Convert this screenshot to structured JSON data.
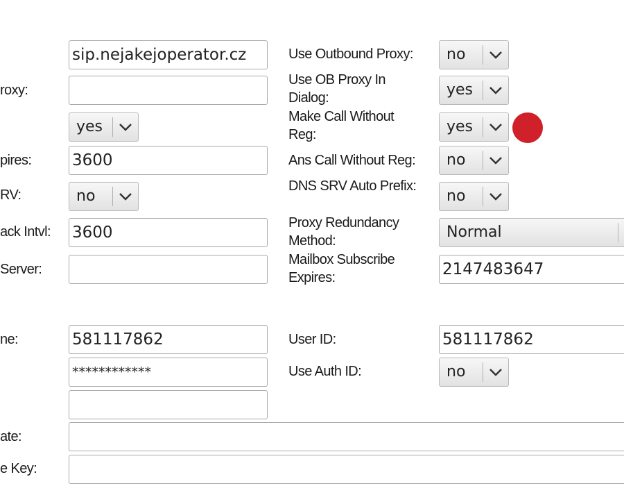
{
  "left": {
    "server_value": "sip.nejakejoperator.cz",
    "proxy_label": "roxy:",
    "proxy_value": "",
    "toggle_value": "yes",
    "expires_label": "pires:",
    "expires_value": "3600",
    "srv_label": "RV:",
    "srv_value": "no",
    "ack_label": "ack Intvl:",
    "ack_value": "3600",
    "server2_label": "Server:",
    "server2_value": "",
    "name_label": "ne:",
    "name_value": "581117862",
    "password_value": "************",
    "blank_value": "",
    "state_label": "ate:",
    "state_value": "",
    "key_label": "e Key:",
    "key_value": ""
  },
  "right": {
    "outbound_proxy_label": "Use Outbound Proxy:",
    "outbound_proxy_value": "no",
    "ob_proxy_dialog_label": "Use OB Proxy In Dialog:",
    "ob_proxy_dialog_value": "yes",
    "call_without_reg_label": "Make Call Without Reg:",
    "call_without_reg_value": "yes",
    "ans_call_label": "Ans Call Without Reg:",
    "ans_call_value": "no",
    "dns_srv_label": "DNS SRV Auto Prefix:",
    "dns_srv_value": "no",
    "proxy_redundancy_label": "Proxy Redundancy Method:",
    "proxy_redundancy_value": "Normal",
    "mailbox_label": "Mailbox Subscribe Expires:",
    "mailbox_value": "2147483647",
    "user_id_label": "User ID:",
    "user_id_value": "581117862",
    "auth_id_label": "Use Auth ID:",
    "auth_id_value": "no"
  },
  "icons": {
    "chevron": "chevron-down-icon",
    "marker": "red-dot-marker"
  },
  "colors": {
    "marker": "#d0202a",
    "field_border": "#a9a9a9",
    "select_gradient_top": "#f7f7f7",
    "select_gradient_bottom": "#e2e2e2"
  }
}
